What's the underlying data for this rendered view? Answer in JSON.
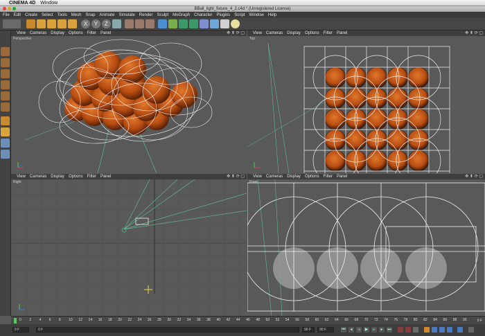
{
  "mac_menubar": {
    "app_name": "CINEMA 4D",
    "menu": "Window"
  },
  "window": {
    "title": "BBall_light_fixture_4_2.c4d * (Unregistered License)"
  },
  "menus": [
    "File",
    "Edit",
    "Create",
    "Select",
    "Tools",
    "Mesh",
    "Snap",
    "Animate",
    "Simulate",
    "Render",
    "Sculpt",
    "MoGraph",
    "Character",
    "Plugins",
    "Script",
    "Window",
    "Help"
  ],
  "viewport_menu": [
    "View",
    "Cameras",
    "Display",
    "Options",
    "Filter",
    "Panel"
  ],
  "viewports": {
    "perspective": {
      "label": "Perspective"
    },
    "top": {
      "label": "Top"
    },
    "right": {
      "label": "Right"
    },
    "front": {
      "label": "Front"
    }
  },
  "toolbar_axes": [
    "X",
    "Y",
    "Z"
  ],
  "timeline": {
    "ticks": [
      "0",
      "2",
      "4",
      "6",
      "8",
      "10",
      "12",
      "14",
      "16",
      "18",
      "20",
      "22",
      "24",
      "26",
      "28",
      "30",
      "32",
      "34",
      "36",
      "38",
      "40",
      "42",
      "44",
      "46",
      "48",
      "50",
      "52",
      "54",
      "56",
      "58",
      "60",
      "62",
      "64",
      "66",
      "68",
      "70",
      "72",
      "74",
      "76",
      "78",
      "80",
      "82",
      "84",
      "86",
      "88",
      "90"
    ],
    "end_label": "0 F"
  },
  "transport": {
    "start_field": "0 F",
    "start_field2": "0 F",
    "end_field": "90 F",
    "end_field2": "90 F"
  },
  "colors": {
    "ball": "#b84d12",
    "wire": "#f0f0f0",
    "green_line": "#5fb88f",
    "grid": "#4e4e4e"
  }
}
